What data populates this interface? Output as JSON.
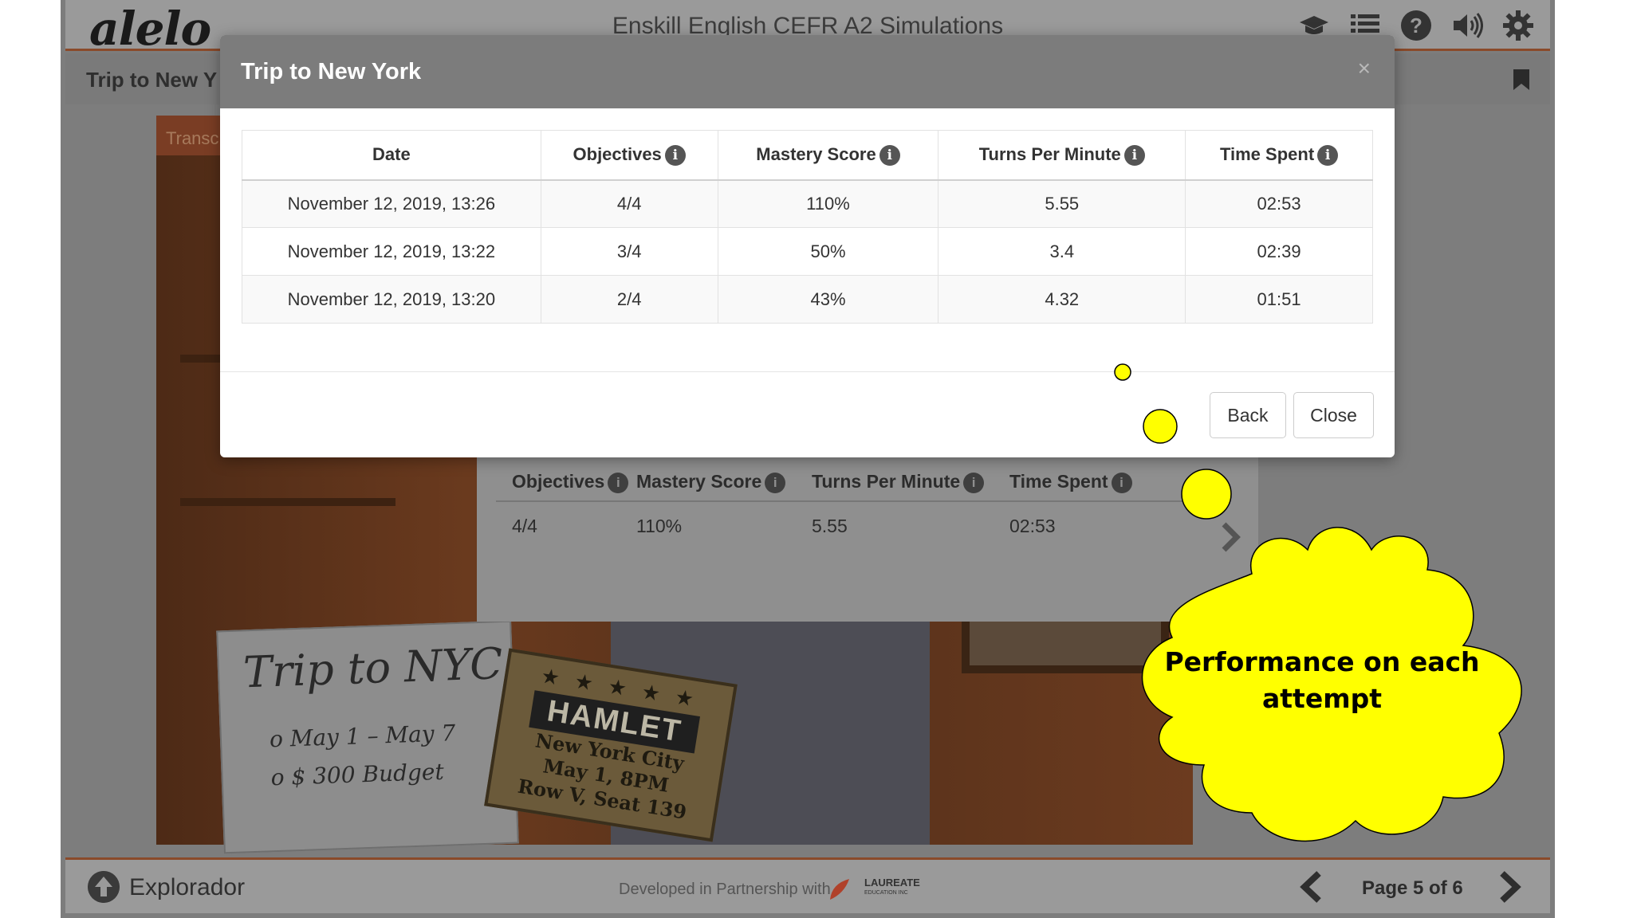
{
  "app": {
    "logo": "alelo",
    "title": "Enskill English CEFR A2 Simulations",
    "scene_title": "Trip to New Y",
    "icons": [
      "graduation-cap-icon",
      "list-icon",
      "help-icon",
      "volume-icon",
      "gear-icon",
      "bookmark-icon"
    ]
  },
  "scene": {
    "transcript_tab": "Transc",
    "notepad": {
      "title": "Trip to NYC",
      "lines": [
        "o May 1 – May 7",
        "o $ 300 Budget"
      ]
    },
    "ticket": {
      "stars_top": "★ ★ ★ ★ ★",
      "show": "HAMLET",
      "lines": [
        "New York City",
        "May 1, 8PM",
        "Row V, Seat 139"
      ],
      "stars_bottom": "★ ★ ★ ★ ★"
    }
  },
  "background_panel": {
    "headers": [
      "Objectives",
      "Mastery Score",
      "Turns Per Minute",
      "Time Spent"
    ],
    "row": [
      "4/4",
      "110%",
      "5.55",
      "02:53"
    ]
  },
  "modal": {
    "title": "Trip to New York",
    "close_glyph": "×",
    "table": {
      "headers": [
        "Date",
        "Objectives",
        "Mastery Score",
        "Turns Per Minute",
        "Time Spent"
      ],
      "rows": [
        [
          "November 12, 2019, 13:26",
          "4/4",
          "110%",
          "5.55",
          "02:53"
        ],
        [
          "November 12, 2019, 13:22",
          "3/4",
          "50%",
          "3.4",
          "02:39"
        ],
        [
          "November 12, 2019, 13:20",
          "2/4",
          "43%",
          "4.32",
          "01:51"
        ]
      ]
    },
    "buttons": {
      "back": "Back",
      "close": "Close"
    }
  },
  "footer": {
    "explorador": "Explorador",
    "partnership": "Developed in Partnership with",
    "partner_name_line1": "LAUREATE",
    "partner_name_line2": "EDUCATION INC",
    "page_indicator": "Page 5 of 6"
  },
  "callout": {
    "text_line1": "Performance on each",
    "text_line2": "attempt",
    "fill": "#ffff00"
  },
  "info_glyph": "i"
}
